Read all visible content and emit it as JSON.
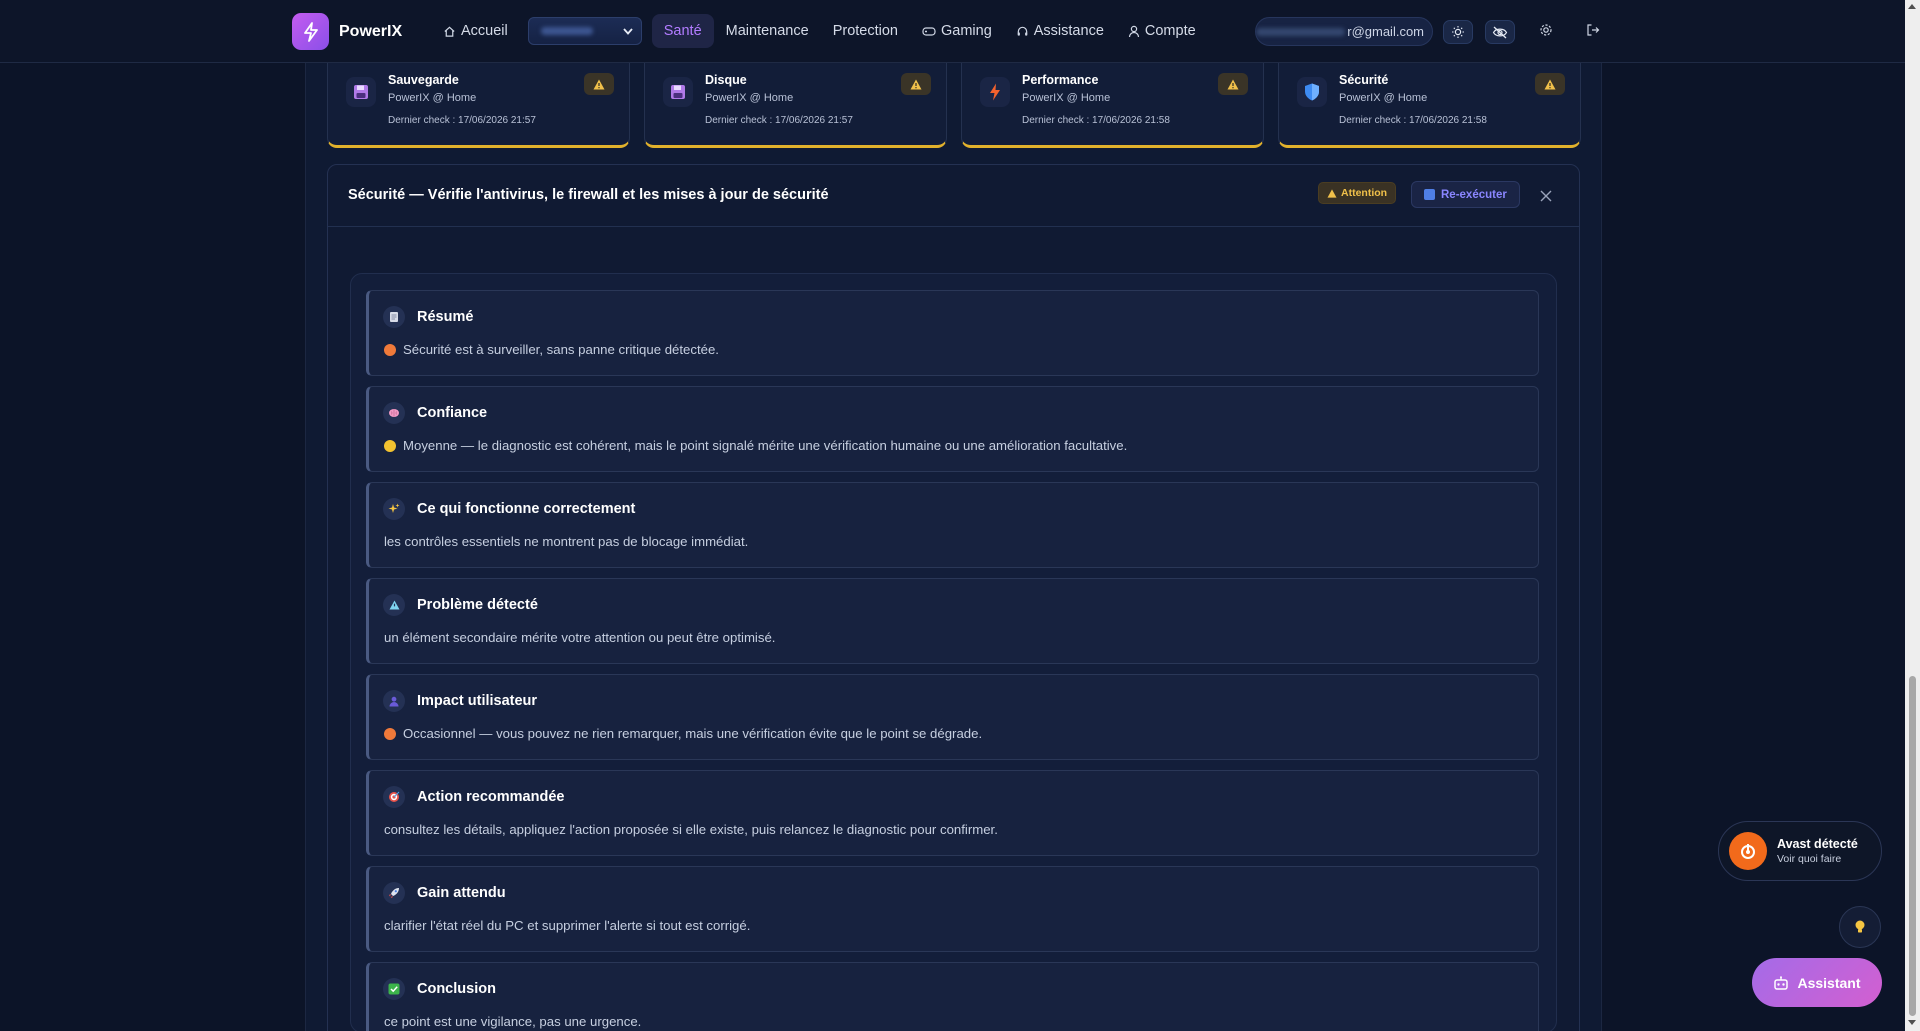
{
  "brand": {
    "name": "PowerIX"
  },
  "nav": {
    "home": "Accueil",
    "health": "Santé",
    "maintenance": "Maintenance",
    "protection": "Protection",
    "gaming": "Gaming",
    "support": "Assistance",
    "account": "Compte"
  },
  "user": {
    "email_suffix": "r@gmail.com"
  },
  "cards": [
    {
      "title": "Sauvegarde",
      "subtitle": "PowerIX @ Home",
      "check": "Dernier check : 17/06/2026 21:57",
      "icon": "floppy-icon"
    },
    {
      "title": "Disque",
      "subtitle": "PowerIX @ Home",
      "check": "Dernier check : 17/06/2026 21:57",
      "icon": "floppy-icon"
    },
    {
      "title": "Performance",
      "subtitle": "PowerIX @ Home",
      "check": "Dernier check : 17/06/2026 21:58",
      "icon": "lightning-icon"
    },
    {
      "title": "Sécurité",
      "subtitle": "PowerIX @ Home",
      "check": "Dernier check : 17/06/2026 21:58",
      "icon": "shield-icon"
    }
  ],
  "detail": {
    "title": "Sécurité — Vérifie l'antivirus, le firewall et les mises à jour de sécurité",
    "status_badge": "Attention",
    "rerun_label": "Re-exécuter"
  },
  "sections": [
    {
      "icon": "memo-icon",
      "title": "Résumé",
      "dot": "#f07a3a",
      "text": "Sécurité est à surveiller, sans panne critique détectée."
    },
    {
      "icon": "brain-icon",
      "title": "Confiance",
      "dot": "#f2c230",
      "text": "Moyenne — le diagnostic est cohérent, mais le point signalé mérite une vérification humaine ou une amélioration facultative."
    },
    {
      "icon": "sparkles-icon",
      "title": "Ce qui fonctionne correctement",
      "dot": "",
      "text": "les contrôles essentiels ne montrent pas de blocage immédiat."
    },
    {
      "icon": "warning-icon",
      "title": "Problème détecté",
      "dot": "",
      "text": "un élément secondaire mérite votre attention ou peut être optimisé."
    },
    {
      "icon": "user-icon",
      "title": "Impact utilisateur",
      "dot": "#f07a3a",
      "text": "Occasionnel — vous pouvez ne rien remarquer, mais une vérification évite que le point se dégrade."
    },
    {
      "icon": "target-icon",
      "title": "Action recommandée",
      "dot": "",
      "text": "consultez les détails, appliquez l'action proposée si elle existe, puis relancez le diagnostic pour confirmer."
    },
    {
      "icon": "rocket-icon",
      "title": "Gain attendu",
      "dot": "",
      "text": "clarifier l'état réel du PC et supprimer l'alerte si tout est corrigé."
    },
    {
      "icon": "check-icon",
      "title": "Conclusion",
      "dot": "",
      "text": "ce point est une vigilance, pas une urgence."
    }
  ],
  "toast": {
    "title": "Avast détecté",
    "subtitle": "Voir quoi faire"
  },
  "assistant": {
    "label": "Assistant"
  },
  "colors": {
    "accent": "#b27cff",
    "warning": "#e1b12c",
    "avast": "#f26a1b"
  }
}
